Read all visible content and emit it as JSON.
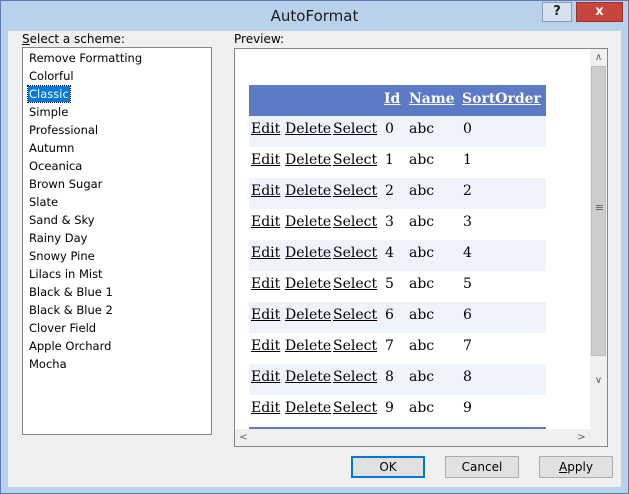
{
  "window": {
    "title": "AutoFormat",
    "help_label": "?",
    "close_label": "x"
  },
  "schemes": {
    "label_prefix": "",
    "label_access": "S",
    "label_rest": "elect a scheme:",
    "selected_index": 2,
    "items": [
      "Remove Formatting",
      "Colorful",
      "Classic",
      "Simple",
      "Professional",
      "Autumn",
      "Oceanica",
      "Brown Sugar",
      "Slate",
      "Sand & Sky",
      "Rainy Day",
      "Snowy Pine",
      "Lilacs in Mist",
      "Black & Blue 1",
      "Black & Blue 2",
      "Clover Field",
      "Apple Orchard",
      "Mocha"
    ]
  },
  "preview": {
    "label": "Preview:",
    "headers": {
      "id": "Id",
      "name": "Name",
      "sortorder": "SortOrder"
    },
    "row_links": {
      "edit": "Edit",
      "delete": "Delete",
      "select": "Select"
    },
    "rows": [
      {
        "id": "0",
        "name": "abc",
        "sort": "0"
      },
      {
        "id": "1",
        "name": "abc",
        "sort": "1"
      },
      {
        "id": "2",
        "name": "abc",
        "sort": "2"
      },
      {
        "id": "3",
        "name": "abc",
        "sort": "3"
      },
      {
        "id": "4",
        "name": "abc",
        "sort": "4"
      },
      {
        "id": "5",
        "name": "abc",
        "sort": "5"
      },
      {
        "id": "6",
        "name": "abc",
        "sort": "6"
      },
      {
        "id": "7",
        "name": "abc",
        "sort": "7"
      },
      {
        "id": "8",
        "name": "abc",
        "sort": "8"
      },
      {
        "id": "9",
        "name": "abc",
        "sort": "9"
      }
    ],
    "colors": {
      "header_bg": "#5d7ac6",
      "odd_row_bg": "#eff3fb",
      "even_row_bg": "#ffffff"
    },
    "scroll": {
      "up": "∧",
      "down": "∨",
      "left": "<",
      "right": ">",
      "grip": "≡"
    }
  },
  "buttons": {
    "ok": "OK",
    "cancel": "Cancel",
    "apply_access": "A",
    "apply_rest": "pply"
  }
}
